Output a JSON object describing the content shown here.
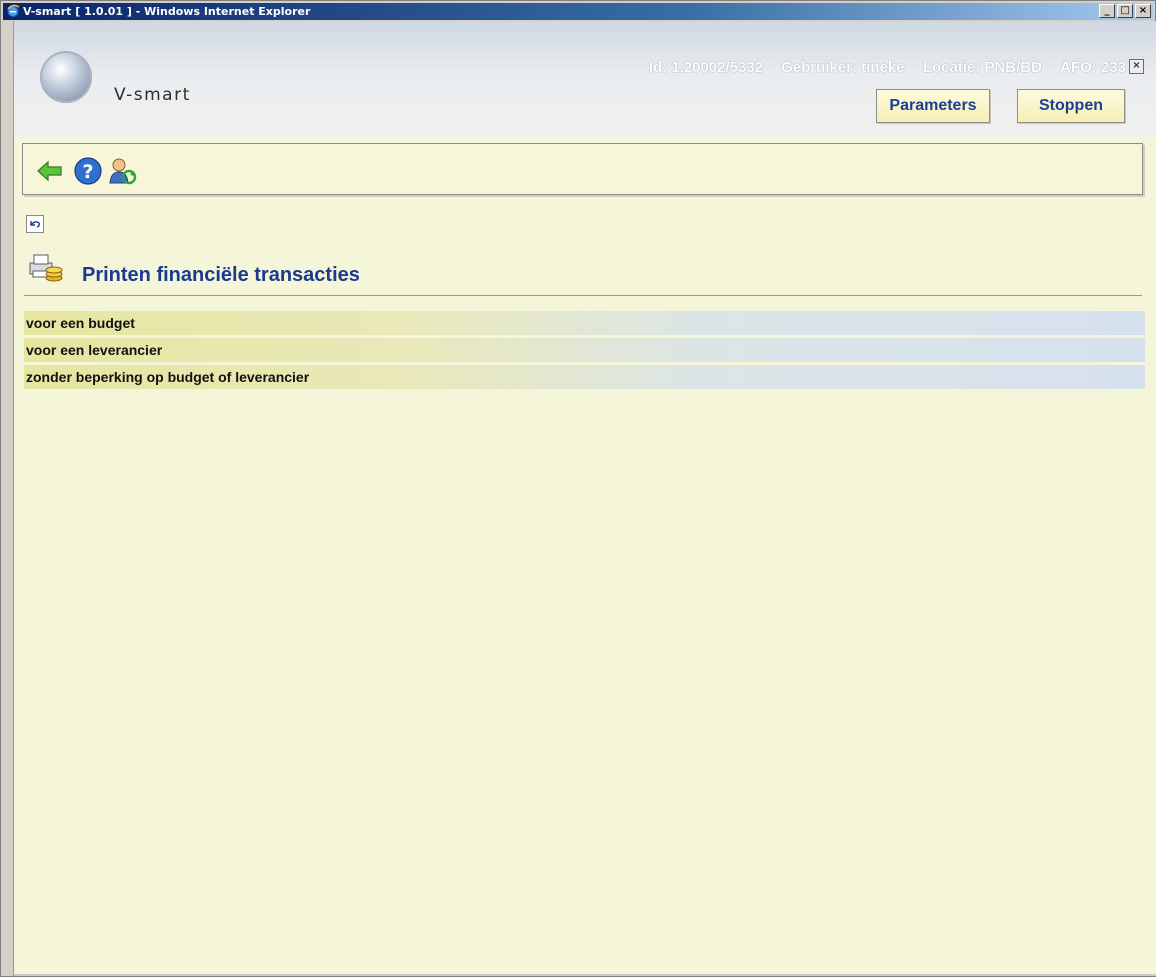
{
  "window": {
    "title": "V-smart [ 1.0.01 ] - Windows Internet Explorer",
    "controls": {
      "minimize": "_",
      "maximize": "□",
      "close": "×"
    }
  },
  "header": {
    "logo_text": "V-smart",
    "id_label": "Id: 1.20002/5332",
    "user_label": "Gebruiker: tineke",
    "location_label": "Locatie: PNB/BD",
    "afo_label": "AFO: 233",
    "close_glyph": "×",
    "buttons": {
      "parameters": "Parameters",
      "stop": "Stoppen"
    }
  },
  "toolbar": {
    "icons": [
      "back-arrow-icon",
      "help-icon",
      "user-refresh-icon"
    ]
  },
  "page": {
    "undo_icon": "undo-icon",
    "title_icon": "printer-coins-icon",
    "title": "Printen financiële transacties"
  },
  "menu": {
    "items": [
      {
        "label": "voor een budget"
      },
      {
        "label": "voor een leverancier"
      },
      {
        "label": "zonder beperking op budget of leverancier"
      }
    ]
  },
  "colors": {
    "title_text": "#1a3a8e",
    "button_text": "#1c3f94",
    "content_bg": "#f5f5d9"
  }
}
